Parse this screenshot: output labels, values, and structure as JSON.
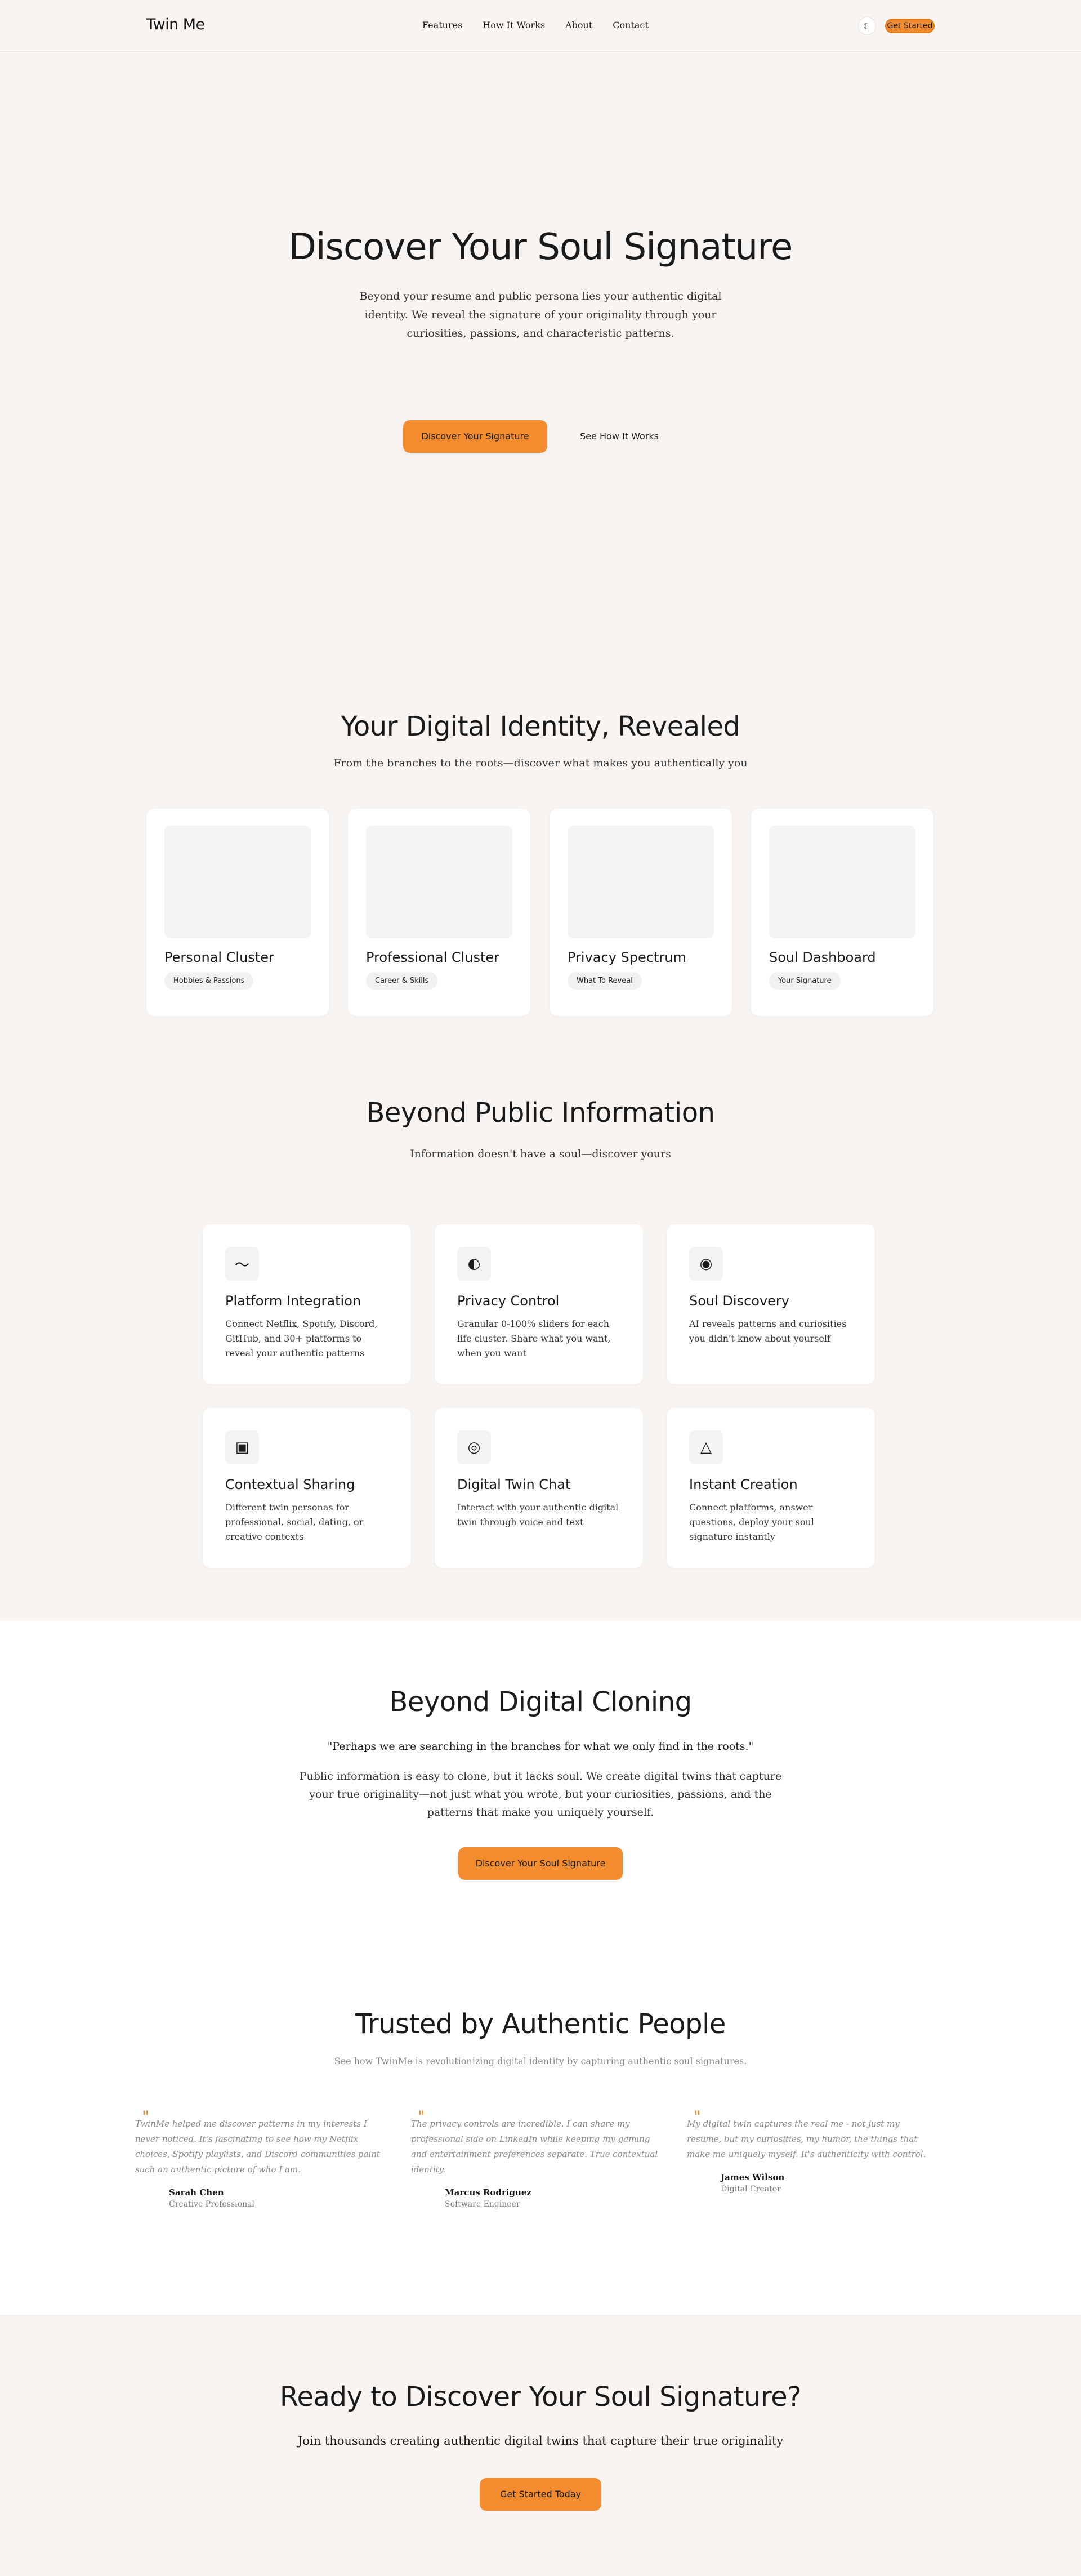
{
  "header": {
    "logo": "Twin Me",
    "nav": [
      "Features",
      "How It Works",
      "About",
      "Contact"
    ],
    "theme_icon": "moon-icon",
    "cta": "Get Started"
  },
  "hero": {
    "title": "Discover Your Soul Signature",
    "description": "Beyond your resume and public persona lies your authentic digital identity. We reveal the signature of your originality through your curiosities, passions, and characteristic patterns.",
    "primary_button": "Discover Your Signature",
    "secondary_button": "See How It Works"
  },
  "identity": {
    "title": "Your Digital Identity, Revealed",
    "subtitle": "From the branches to the roots—discover what makes you authentically you",
    "cards": [
      {
        "title": "Personal Cluster",
        "tag": "Hobbies & Passions"
      },
      {
        "title": "Professional Cluster",
        "tag": "Career & Skills"
      },
      {
        "title": "Privacy Spectrum",
        "tag": "What To Reveal"
      },
      {
        "title": "Soul Dashboard",
        "tag": "Your Signature"
      }
    ]
  },
  "beyond": {
    "title": "Beyond Public Information",
    "subtitle": "Information doesn't have a soul—discover yours",
    "features": [
      {
        "icon": "wave-icon",
        "glyph": "〜",
        "title": "Platform Integration",
        "text": "Connect Netflix, Spotify, Discord, GitHub, and 30+ platforms to reveal your authentic patterns"
      },
      {
        "icon": "half-circle-icon",
        "glyph": "◐",
        "title": "Privacy Control",
        "text": "Granular 0-100% sliders for each life cluster. Share what you want, when you want"
      },
      {
        "icon": "target-icon",
        "glyph": "◉",
        "title": "Soul Discovery",
        "text": "AI reveals patterns and curiosities you didn't know about yourself"
      },
      {
        "icon": "square-icon",
        "glyph": "▣",
        "title": "Contextual Sharing",
        "text": "Different twin personas for professional, social, dating, or creative contexts"
      },
      {
        "icon": "ring-icon",
        "glyph": "◎",
        "title": "Digital Twin Chat",
        "text": "Interact with your authentic digital twin through voice and text"
      },
      {
        "icon": "triangle-icon",
        "glyph": "△",
        "title": "Instant Creation",
        "text": "Connect platforms, answer questions, deploy your soul signature instantly"
      }
    ]
  },
  "cloning": {
    "title": "Beyond Digital Cloning",
    "quote": "\"Perhaps we are searching in the branches for what we only find in the roots.\"",
    "body": "Public information is easy to clone, but it lacks soul. We create digital twins that capture your true originality—not just what you wrote, but your curiosities, passions, and the patterns that make you uniquely yourself.",
    "button": "Discover Your Soul Signature"
  },
  "trusted": {
    "title": "Trusted by Authentic People",
    "subtitle": "See how TwinMe is revolutionizing digital identity by capturing authentic soul signatures.",
    "testimonials": [
      {
        "quote": "TwinMe helped me discover patterns in my interests I never noticed. It's fascinating to see how my Netflix choices, Spotify playlists, and Discord communities paint such an authentic picture of who I am.",
        "name": "Sarah Chen",
        "role": "Creative Professional"
      },
      {
        "quote": "The privacy controls are incredible. I can share my professional side on LinkedIn while keeping my gaming and entertainment preferences separate. True contextual identity.",
        "name": "Marcus Rodriguez",
        "role": "Software Engineer"
      },
      {
        "quote": "My digital twin captures the real me - not just my resume, but my curiosities, my humor, the things that make me uniquely myself. It's authenticity with control.",
        "name": "James Wilson",
        "role": "Digital Creator"
      }
    ]
  },
  "cta": {
    "title": "Ready to Discover Your Soul Signature?",
    "subtitle": "Join thousands creating authentic digital twins that capture their true originality",
    "button": "Get Started Today"
  },
  "colors": {
    "accent": "#f28c2e",
    "background": "#f8f4f1",
    "card": "#ffffff"
  }
}
